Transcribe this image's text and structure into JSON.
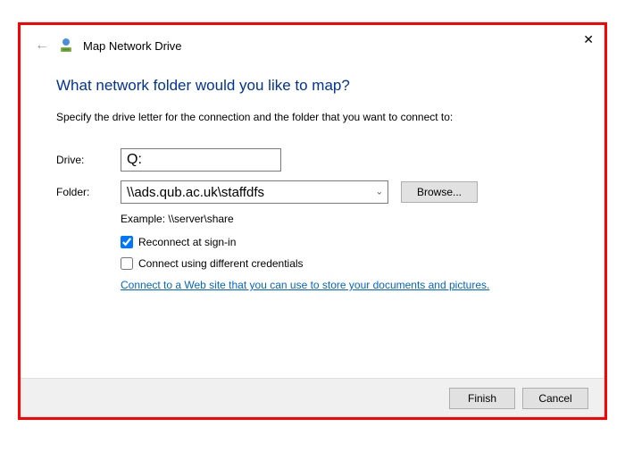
{
  "window": {
    "title": "Map Network Drive"
  },
  "heading": "What network folder would you like to map?",
  "instruction": "Specify the drive letter for the connection and the folder that you want to connect to:",
  "form": {
    "drive_label": "Drive:",
    "drive_value": "Q:",
    "folder_label": "Folder:",
    "folder_value": "\\\\ads.qub.ac.uk\\staffdfs",
    "browse_label": "Browse...",
    "example_text": "Example: \\\\server\\share",
    "reconnect_label": "Reconnect at sign-in",
    "reconnect_checked": true,
    "diff_creds_label": "Connect using different credentials",
    "diff_creds_checked": false,
    "link_text": "Connect to a Web site that you can use to store your documents and pictures"
  },
  "footer": {
    "finish_label": "Finish",
    "cancel_label": "Cancel"
  }
}
